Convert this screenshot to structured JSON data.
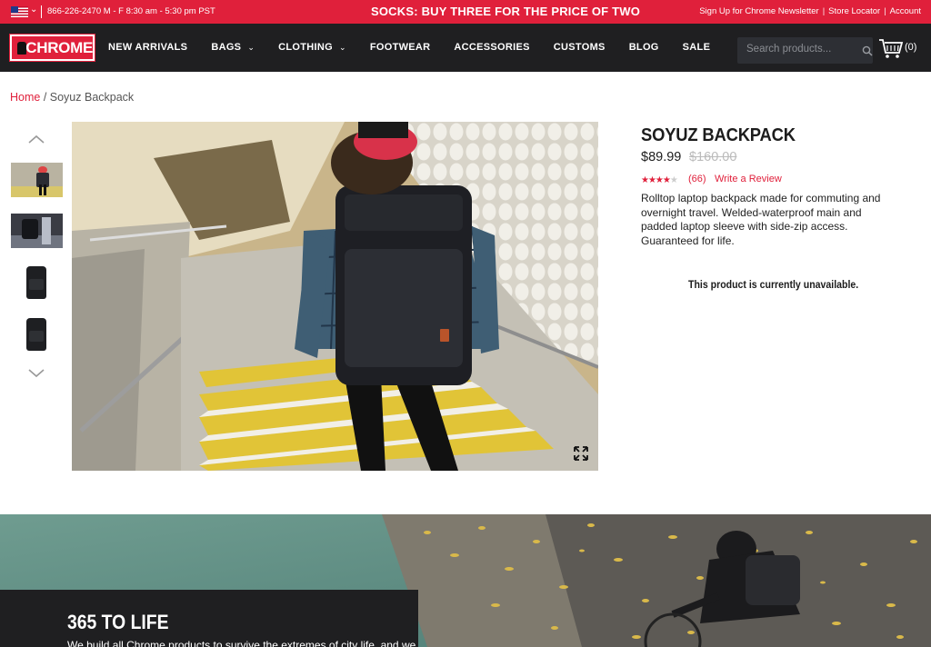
{
  "topbar": {
    "phone_hours": "866-226-2470 M - F 8:30 am - 5:30 pm PST",
    "promo": "SOCKS: BUY THREE FOR THE PRICE OF TWO",
    "links": [
      "Sign Up for Chrome Newsletter",
      "Store Locator",
      "Account"
    ],
    "separator": "|",
    "chevron": "⌄"
  },
  "nav": {
    "logo": "CHROME",
    "items": [
      {
        "label": "NEW ARRIVALS"
      },
      {
        "label": "BAGS",
        "dropdown": "⌄"
      },
      {
        "label": "CLOTHING",
        "dropdown": "⌄"
      },
      {
        "label": "FOOTWEAR"
      },
      {
        "label": "ACCESSORIES"
      },
      {
        "label": "CUSTOMS"
      },
      {
        "label": "BLOG"
      },
      {
        "label": "SALE"
      }
    ],
    "search_placeholder": "Search products...",
    "cart_count": "(0)"
  },
  "breadcrumb": {
    "home": "Home",
    "separator": " / ",
    "current": "Soyuz Backpack"
  },
  "product": {
    "title": "SOYUZ BACKPACK",
    "price": "$89.99",
    "old_price": "$160.00",
    "stars_on": "★★★★",
    "stars_off": "★",
    "review_count": "(66)",
    "write_review": "Write a Review",
    "description": "Rolltop laptop backpack made for commuting and overnight travel. Welded-waterproof main and padded laptop sleeve with side-zip access. Guaranteed for life.",
    "unavailable": "This product is currently unavailable."
  },
  "banner": {
    "title": "365 TO LIFE",
    "text": "We build all Chrome products to survive the extremes of city life, and we"
  },
  "colors": {
    "brand_red": "#e0203b",
    "nav_dark": "#1f1f21"
  },
  "icons": [
    "us-flag-icon",
    "search-icon",
    "cart-icon",
    "chevron-up-icon",
    "chevron-down-icon",
    "expand-icon"
  ]
}
